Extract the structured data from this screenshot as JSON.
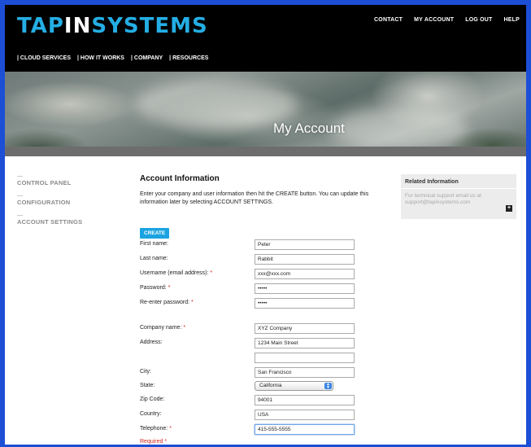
{
  "brand": {
    "part1": "TAP",
    "part2": "IN",
    "part3": "SYSTEMS"
  },
  "util_nav": [
    "CONTACT",
    "MY ACCOUNT",
    "LOG OUT",
    "HELP"
  ],
  "main_nav": [
    "CLOUD SERVICES",
    "HOW IT WORKS",
    "COMPANY",
    "RESOURCES"
  ],
  "hero": {
    "title": "My Account"
  },
  "sidebar": {
    "dash": "—",
    "items": [
      "CONTROL PANEL",
      "CONFIGURATION",
      "ACCOUNT SETTINGS"
    ]
  },
  "content": {
    "title": "Account Information",
    "intro": "Enter your company and user information then hit the CREATE button. You can update this information later by selecting ACCOUNT SETTINGS.",
    "create_label": "CREATE"
  },
  "form": {
    "required_mark": "*",
    "rows": [
      {
        "label": "First name:",
        "value": "Peter",
        "required": false
      },
      {
        "label": "Last name:",
        "value": "Rabbit",
        "required": false
      },
      {
        "label": "Username (email address):",
        "value": "xxx@xxx.com",
        "required": true
      },
      {
        "label": "Password:",
        "value": "•••••",
        "required": true
      },
      {
        "label": "Re-enter password:",
        "value": "•••••",
        "required": true
      },
      {
        "label": "Company name:",
        "value": "XYZ Company",
        "required": true
      },
      {
        "label": "Address:",
        "value": "1234 Main Street",
        "required": false
      },
      {
        "label": "",
        "value": "",
        "required": false
      },
      {
        "label": "City:",
        "value": "San Francisco",
        "required": false
      },
      {
        "label": "State:",
        "value": "California",
        "required": false
      },
      {
        "label": "Zip Code:",
        "value": "94001",
        "required": false
      },
      {
        "label": "Country:",
        "value": "USA",
        "required": false
      },
      {
        "label": "Telephone:",
        "value": "415-555-5555",
        "required": true
      }
    ],
    "required_note": "Required *"
  },
  "related": {
    "title": "Related Information",
    "body": "For technical support email us at support@tapinsystems.com",
    "plus": "+"
  },
  "colors": {
    "accent": "#24aee4",
    "button": "#1aa3e0",
    "required": "#d0241c"
  }
}
